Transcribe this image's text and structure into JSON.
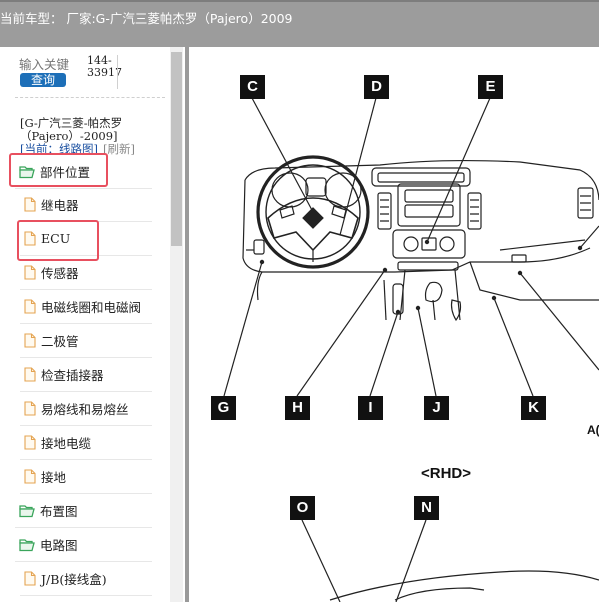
{
  "header": {
    "title": "当前车型：  厂家:G-广汽三菱帕杰罗（Pajero）2009"
  },
  "search": {
    "placeholder": "输入关键",
    "button_label": "查询",
    "code_line1": "144-",
    "code_line2": "33917"
  },
  "model": {
    "name": "[G-广汽三菱-帕杰罗（Pajero）-2009]",
    "current_label": "[当前：线路图]",
    "refresh_label": "[刷新]"
  },
  "tree": [
    {
      "label": "部件位置",
      "kind": "folder-open",
      "level": 0
    },
    {
      "label": "继电器",
      "kind": "file",
      "level": 1
    },
    {
      "label": "ECU",
      "kind": "file",
      "level": 1
    },
    {
      "label": "传感器",
      "kind": "file",
      "level": 1
    },
    {
      "label": "电磁线圈和电磁阀",
      "kind": "file",
      "level": 1
    },
    {
      "label": "二极管",
      "kind": "file",
      "level": 1
    },
    {
      "label": "检查插接器",
      "kind": "file",
      "level": 1
    },
    {
      "label": "易熔线和易熔丝",
      "kind": "file",
      "level": 1
    },
    {
      "label": "接地电缆",
      "kind": "file",
      "level": 1
    },
    {
      "label": "接地",
      "kind": "file",
      "level": 1
    },
    {
      "label": "布置图",
      "kind": "folder-open",
      "level": 0
    },
    {
      "label": "电路图",
      "kind": "folder-open",
      "level": 0
    },
    {
      "label": "J/B(接线盒)",
      "kind": "file",
      "level": 1
    }
  ],
  "diagram": {
    "callouts": {
      "c": "C",
      "d": "D",
      "e": "E",
      "g": "G",
      "h": "H",
      "i": "I",
      "j": "J",
      "k": "K",
      "o": "O",
      "n": "N"
    },
    "rhd_label": "<RHD>",
    "cut_label": "A("
  },
  "colors": {
    "topbar": "#9c9c9c",
    "highlight": "#e8505f",
    "button": "#1d6fb8",
    "folder": "#3aa55b"
  }
}
